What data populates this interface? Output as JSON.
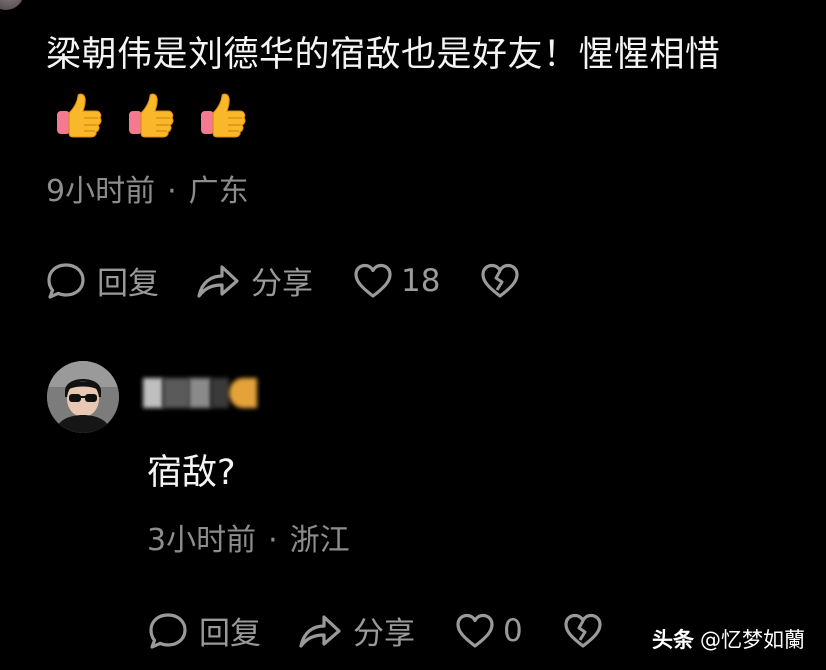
{
  "comment": {
    "text": "梁朝伟是刘德华的宿敌也是好友！惺惺相惜",
    "emoji_icons": [
      "thumbs-up-icon",
      "thumbs-up-icon",
      "thumbs-up-icon"
    ],
    "time": "9小时前",
    "separator": "·",
    "location": "广东",
    "actions": {
      "reply_label": "回复",
      "share_label": "分享",
      "like_count": "18"
    }
  },
  "reply": {
    "text": "宿敌?",
    "time": "3小时前",
    "separator": "·",
    "location": "浙江",
    "actions": {
      "reply_label": "回复",
      "share_label": "分享",
      "like_count": "0"
    }
  },
  "watermark": {
    "brand": "头条",
    "handle": "@忆梦如蘭"
  },
  "colors": {
    "background": "#000000",
    "primary_text": "#f4f4f4",
    "secondary_text": "#8d8d8d",
    "icon_gray": "#9a9a9a"
  }
}
